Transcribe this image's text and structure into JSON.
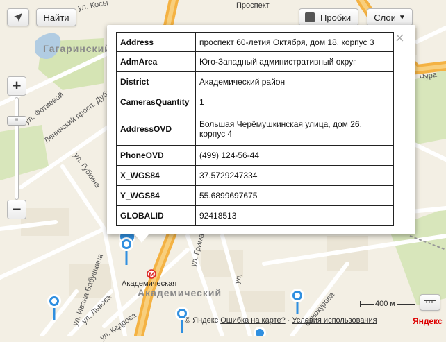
{
  "toolbar": {
    "find_label": "Найти",
    "traffic_label": "Пробки",
    "layers_label": "Слои"
  },
  "map_labels": {
    "prospekt": "Проспект",
    "gagarinsky": "Гагаринский",
    "kosygina": "ул. Косы",
    "fotievoy": "ул. Фотиевой",
    "leninsky": "Ленинский просп. Дубле",
    "gubkina": "ул. Губкина",
    "ivanova": "ул. Ивана Бабушкина",
    "lvova": "ул. Львова",
    "kedrova": "ул. Кедрова",
    "grimau": "ул. Гримау",
    "dmitr": "ул.",
    "vinokurova": "Винокурова",
    "chura": "Чура",
    "metro": "Академическая",
    "district": "Академический"
  },
  "scale": {
    "label": "400 м"
  },
  "footer": {
    "copyright": "© Яндекс",
    "error_link": "Ошибка на карте?",
    "separator": "·",
    "terms_link": "Условия использования",
    "logo": "Яндекс"
  },
  "balloon": {
    "close_glyph": "×",
    "rows": [
      {
        "key": "Address",
        "value": "проспект 60-летия Октября, дом 18, корпус 3"
      },
      {
        "key": "AdmArea",
        "value": "Юго-Западный административный округ"
      },
      {
        "key": "District",
        "value": "Академический район"
      },
      {
        "key": "CamerasQuantity",
        "value": "1"
      },
      {
        "key": "AddressOVD",
        "value": "Большая Черёмушкинская улица, дом 26, корпус 4"
      },
      {
        "key": "PhoneOVD",
        "value": "(499) 124-56-44"
      },
      {
        "key": "X_WGS84",
        "value": "37.5729247334"
      },
      {
        "key": "Y_WGS84",
        "value": "55.6899697675"
      },
      {
        "key": "GLOBALID",
        "value": "92418513"
      }
    ]
  },
  "colors": {
    "map_bg": "#f3efe4",
    "major_road": "#f4b243",
    "street": "#ffffff",
    "park": "#d5e4b4",
    "water": "#b1cce2",
    "pin": "#2f8fe0"
  }
}
